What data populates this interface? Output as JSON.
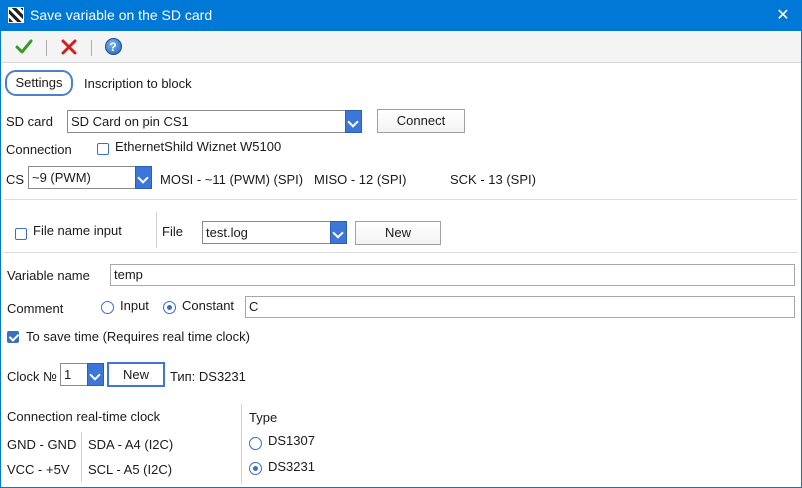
{
  "window": {
    "title": "Save variable on the SD card",
    "close_glyph": "✕"
  },
  "toolbar": {
    "ok_icon": "check-icon",
    "cancel_icon": "close-icon",
    "help_icon": "help-icon",
    "help_glyph": "?",
    "ok_color": "#3a9a2a",
    "cancel_color": "#d01f1f"
  },
  "tabs": [
    {
      "label": "Settings",
      "active": true
    },
    {
      "label": "Inscription to block",
      "active": false
    }
  ],
  "sd": {
    "label": "SD card",
    "card_value": "SD Card on  pin CS1",
    "connect_label": "Connect",
    "connection_label": "Connection",
    "ethernet_label": "EthernetShild Wiznet W5100",
    "ethernet_checked": false,
    "cs_label": "CS",
    "cs_value": "~9 (PWM)",
    "mosi_text": "MOSI - ~11 (PWM) (SPI)",
    "miso_text": "MISO - 12 (SPI)",
    "sck_text": "SCK - 13 (SPI)"
  },
  "file": {
    "file_name_input_label": "File name input",
    "file_name_input_checked": false,
    "file_label": "File",
    "file_value": "test.log",
    "new_label": "New"
  },
  "variable": {
    "name_label": "Variable name",
    "name_value": "temp",
    "comment_label": "Comment",
    "input_option": "Input",
    "constant_option": "Constant",
    "selected": "Constant",
    "comment_value": "C",
    "save_time_label": "To save time (Requires real time clock)",
    "save_time_checked": true
  },
  "clock": {
    "label": "Clock №",
    "value": "1",
    "new_label": "New",
    "type_text": "Тип: DS3231",
    "connection_title": "Connection real-time clock",
    "gnd": "GND - GND",
    "vcc": "VCC - +5V",
    "sda": "SDA - A4 (I2C)",
    "scl": "SCL - A5 (I2C)",
    "type_title": "Type",
    "type_options": [
      "DS1307",
      "DS3231"
    ],
    "type_selected": "DS3231"
  },
  "colors": {
    "titlebar": "#0078d7",
    "accent": "#3b6fc6"
  }
}
